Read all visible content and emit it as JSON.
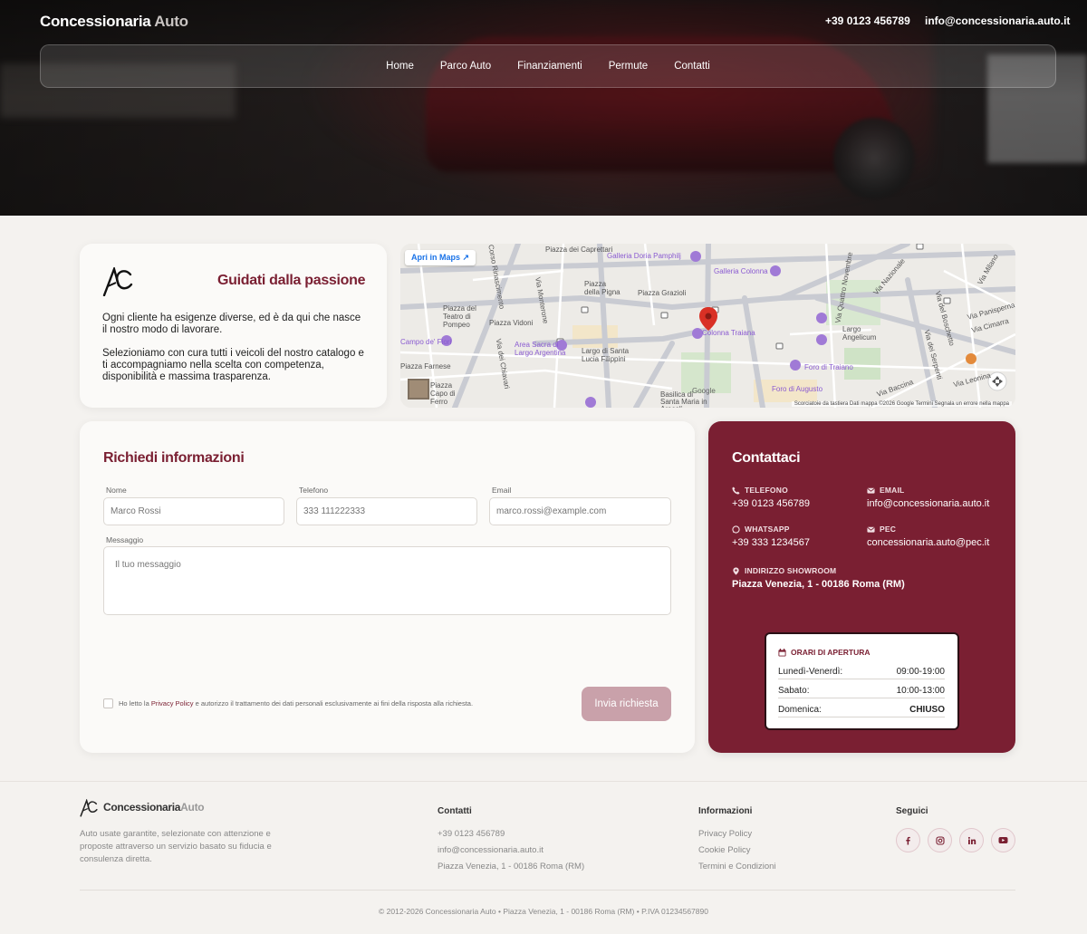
{
  "header": {
    "brand_main": "Concessionaria",
    "brand_accent": "Auto",
    "phone": "+39 0123 456789",
    "email": "info@concessionaria.auto.it"
  },
  "nav": {
    "items": [
      {
        "label": "Home"
      },
      {
        "label": "Parco Auto"
      },
      {
        "label": "Finanziamenti"
      },
      {
        "label": "Permute"
      },
      {
        "label": "Contatti"
      }
    ]
  },
  "intro": {
    "title": "Guidati dalla passione",
    "paragraph1": "Ogni cliente ha esigenze diverse, ed è da qui che nasce il nostro modo di lavorare.",
    "paragraph2": "Selezioniamo con cura tutti i veicoli del nostro catalogo e ti accompagniamo nella scelta con competenza, disponibilità e massima trasparenza."
  },
  "map": {
    "open_in_maps": "Apri in Maps",
    "credit": "Scorciatoie da tastiera   Dati mappa ©2026 Google   Termini   Segnala un errore nella mappa",
    "labels": [
      "Piazza dei Caprettari",
      "Galleria Doria Pamphilj",
      "Galleria Colonna",
      "Piazza della Pigna",
      "Piazza Grazioli",
      "Piazza del Teatro di Pompeo",
      "Piazza Vidoni",
      "Colonna Traiana",
      "Area Sacra di Largo Argentina",
      "Largo di Santa Lucia Filippini",
      "Foro di Traiano",
      "Largo Angelicum",
      "Foro di Augusto",
      "Basilica di Santa Maria in Araceli",
      "Via Panisperna",
      "Via Cimarra",
      "Via Leonina",
      "Via Baccina",
      "Via Nazionale",
      "Via Milano",
      "Via Quattro Novembre",
      "Via del Boschetto",
      "Via dei Serpenti",
      "Piazza Capo di Ferro",
      "Piazza Farnese",
      "Campo de' Fiori",
      "Via dei Chiavari",
      "Via Monterone",
      "Corso Rinascimento",
      "Google"
    ]
  },
  "form": {
    "title": "Richiedi informazioni",
    "name_label": "Nome",
    "name_placeholder": "Marco Rossi",
    "phone_label": "Telefono",
    "phone_placeholder": "333 111222333",
    "email_label": "Email",
    "email_placeholder": "marco.rossi@example.com",
    "message_label": "Messaggio",
    "message_placeholder": "Il tuo messaggio",
    "consent_pre": "Ho letto la ",
    "consent_link": "Privacy Policy",
    "consent_post": " e autorizzo il trattamento dei dati personali esclusivamente ai fini della risposta alla richiesta.",
    "submit": "Invia richiesta"
  },
  "contact": {
    "title": "Contattaci",
    "phone_label": "TELEFONO",
    "phone_value": "+39 0123 456789",
    "email_label": "EMAIL",
    "email_value": "info@concessionaria.auto.it",
    "whatsapp_label": "WHATSAPP",
    "whatsapp_value": "+39 333 1234567",
    "pec_label": "PEC",
    "pec_value": "concessionaria.auto@pec.it",
    "address_label": "INDIRIZZO SHOWROOM",
    "address_value": "Piazza Venezia, 1 - 00186 Roma (RM)",
    "hours_title": "ORARI DI APERTURA",
    "hours": [
      {
        "day": "Lunedì-Venerdì:",
        "time": "09:00-19:00"
      },
      {
        "day": "Sabato:",
        "time": "10:00-13:00"
      },
      {
        "day": "Domenica:",
        "time": "CHIUSO"
      }
    ]
  },
  "footer": {
    "brand_main": "Concessionaria",
    "brand_accent": "Auto",
    "description": "Auto usate garantite, selezionate con attenzione e proposte attraverso un servizio basato su fiducia e consulenza diretta.",
    "contacts_title": "Contatti",
    "contacts": [
      "+39 0123 456789",
      "info@concessionaria.auto.it",
      "Piazza Venezia, 1 - 00186 Roma (RM)"
    ],
    "info_title": "Informazioni",
    "info_links": [
      "Privacy Policy",
      "Cookie Policy",
      "Termini e Condizioni"
    ],
    "social_title": "Seguici",
    "socials": [
      "facebook-icon",
      "instagram-icon",
      "linkedin-icon",
      "youtube-icon"
    ],
    "copyright": "© 2012-2026 Concessionaria Auto • Piazza Venezia, 1 - 00186 Roma (RM) • P.IVA 01234567890"
  },
  "colors": {
    "brand": "#7a1f32",
    "submit_disabled": "#c9a1aa",
    "background": "#f4f2ef"
  }
}
